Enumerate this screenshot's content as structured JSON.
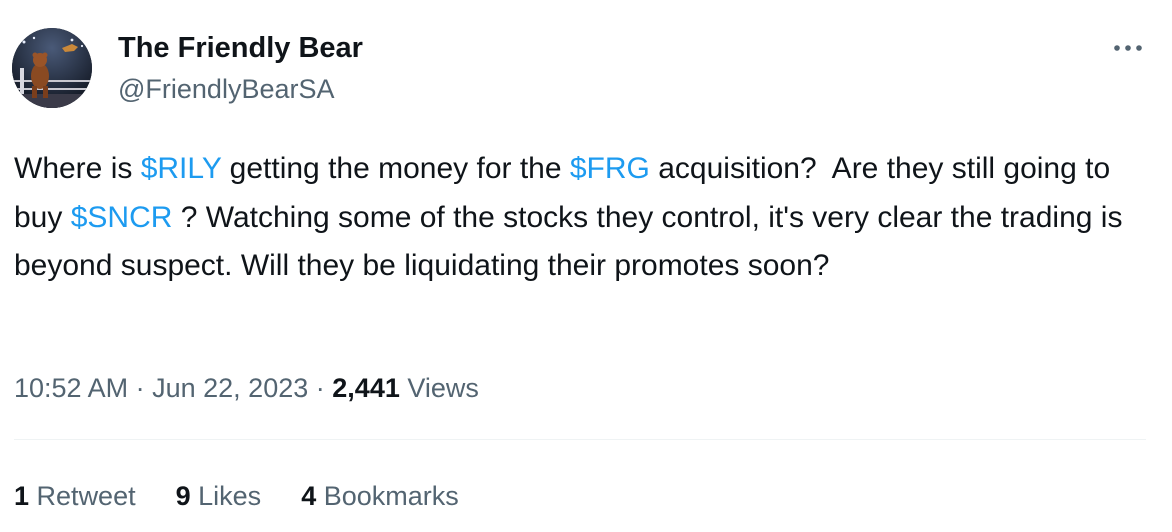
{
  "author": {
    "name": "The Friendly Bear",
    "handle": "@FriendlyBearSA"
  },
  "tweet": {
    "segments": [
      {
        "text": "Where is ",
        "type": "text"
      },
      {
        "text": "$RILY",
        "type": "cashtag"
      },
      {
        "text": " getting the money for the ",
        "type": "text"
      },
      {
        "text": "$FRG",
        "type": "cashtag"
      },
      {
        "text": " acquisition?  Are they still going to buy ",
        "type": "text"
      },
      {
        "text": "$SNCR",
        "type": "cashtag"
      },
      {
        "text": " ? Watching some of the stocks they control, it's very clear the trading is beyond suspect. Will they be liquidating their promotes soon?",
        "type": "text"
      }
    ]
  },
  "meta": {
    "time": "10:52 AM",
    "separator": "·",
    "date": "Jun 22, 2023",
    "views_count": "2,441",
    "views_label": "Views"
  },
  "stats": [
    {
      "count": "1",
      "label": "Retweet"
    },
    {
      "count": "9",
      "label": "Likes"
    },
    {
      "count": "4",
      "label": "Bookmarks"
    }
  ],
  "colors": {
    "cashtag": "#1d9bf0",
    "secondary_text": "#536471",
    "primary_text": "#0f1419",
    "divider": "#eff3f4"
  },
  "icons": {
    "more": "more-horizontal-icon"
  }
}
